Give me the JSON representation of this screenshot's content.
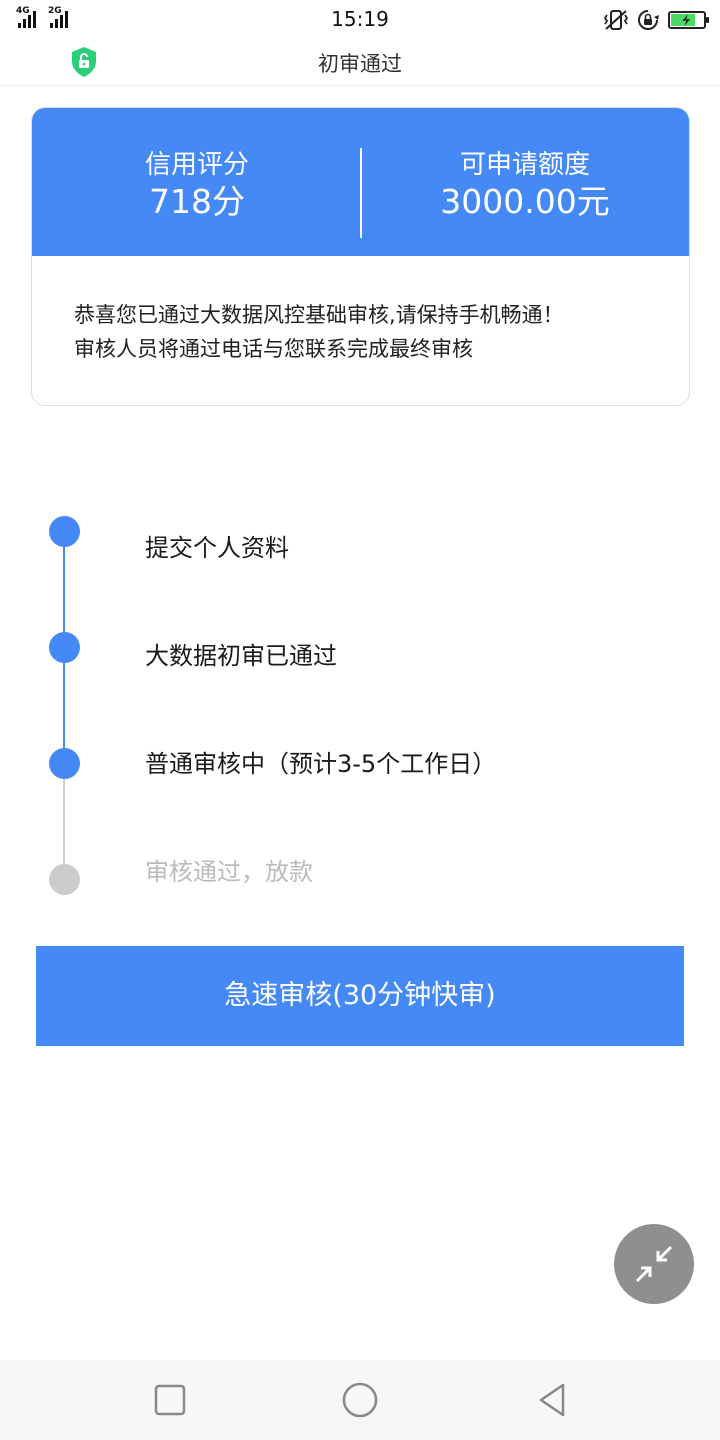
{
  "status_bar": {
    "network_1": "4G",
    "network_2": "2G",
    "time": "15:19",
    "icons": [
      "signal-icon",
      "vibrate-icon",
      "rotation-lock-icon",
      "battery-charging-icon"
    ]
  },
  "header": {
    "title": "初审通过",
    "icon": "shield-icon"
  },
  "card": {
    "credit_label": "信用评分",
    "credit_value": "718分",
    "quota_label": "可申请额度",
    "quota_value": "3000.00元",
    "message_line1": "恭喜您已通过大数据风控基础审核,请保持手机畅通！",
    "message_line2": "审核人员将通过电话与您联系完成最终审核"
  },
  "timeline": {
    "steps": [
      {
        "label": "提交个人资料",
        "state": "done"
      },
      {
        "label": "大数据初审已通过",
        "state": "done"
      },
      {
        "label": "普通审核中（预计3-5个工作日）",
        "state": "current"
      },
      {
        "label": "审核通过，放款",
        "state": "pending"
      }
    ]
  },
  "action": {
    "fast_review_label": "急速审核(30分钟快审)"
  },
  "colors": {
    "accent": "#4489f5",
    "pending": "#cccccc",
    "fab": "#8f8f8f"
  },
  "nav_bar": {
    "icons": [
      "recent-apps-icon",
      "home-icon",
      "back-icon"
    ]
  }
}
